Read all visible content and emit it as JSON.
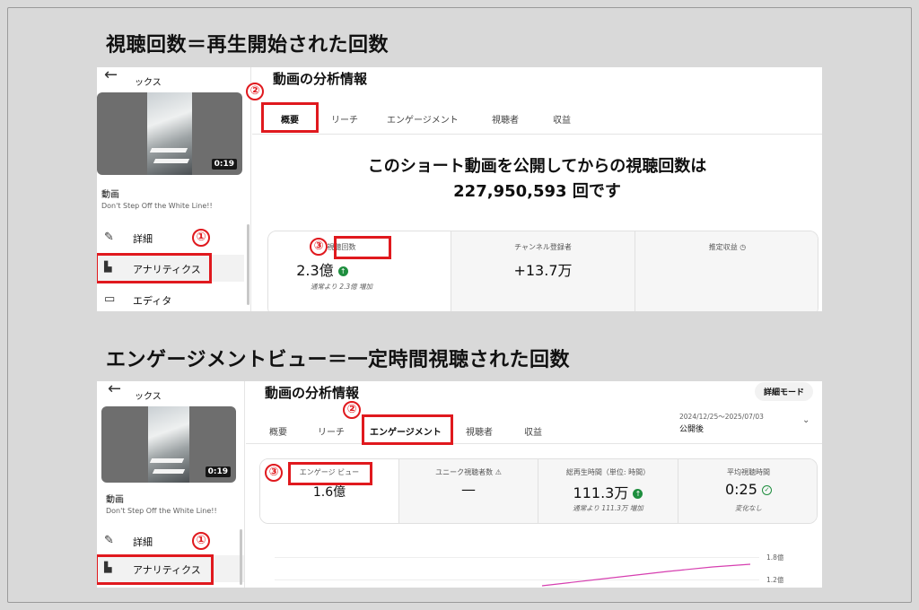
{
  "heading1": "視聴回数＝再生開始された回数",
  "heading2": "エンゲージメントビュー＝一定時間視聴された回数",
  "markers": {
    "one": "①",
    "two": "②",
    "three": "③"
  },
  "sidebar": {
    "channel_title_cut": "ックス",
    "video_kind": "動画",
    "video_name": "Don't Step Off the White Line!!",
    "duration": "0:19",
    "nav": {
      "details": "詳細",
      "analytics": "アナリティクス",
      "editor": "エディタ"
    },
    "icons": {
      "back": "arrow-left-icon",
      "details": "pencil-icon",
      "analytics": "bar-chart-icon",
      "editor": "film-icon"
    }
  },
  "panel1": {
    "title": "動画の分析情報",
    "tabs": [
      "概要",
      "リーチ",
      "エンゲージメント",
      "視聴者",
      "収益"
    ],
    "summary_line1": "このショート動画を公開してからの視聴回数は",
    "summary_line2": "227,950,593 回です",
    "cards": [
      {
        "label": "視聴回数",
        "value": "2.3億",
        "sub": "通常より 2.3億 増加"
      },
      {
        "label": "チャンネル登録者",
        "value": "+13.7万",
        "sub": ""
      },
      {
        "label": "推定収益",
        "value": "",
        "sub": ""
      }
    ]
  },
  "panel2": {
    "title": "動画の分析情報",
    "mode_button": "詳細モード",
    "date_range": "2024/12/25〜2025/07/03",
    "date_label": "公開後",
    "tabs": [
      "概要",
      "リーチ",
      "エンゲージメント",
      "視聴者",
      "収益"
    ],
    "cards": [
      {
        "label": "エンゲージ ビュー",
        "value": "1.6億",
        "sub": ""
      },
      {
        "label": "ユニーク視聴者数",
        "value": "—",
        "sub": ""
      },
      {
        "label": "総再生時間（単位: 時間）",
        "value": "111.3万",
        "sub": "通常より 111.3万 増加"
      },
      {
        "label": "平均視聴時間",
        "value": "0:25",
        "sub": "変化なし"
      }
    ],
    "y_ticks": [
      "1.8億",
      "1.2億"
    ]
  },
  "colors": {
    "highlight": "#e0191e",
    "up_green": "#1e8e3e",
    "line": "#d63fb0"
  }
}
